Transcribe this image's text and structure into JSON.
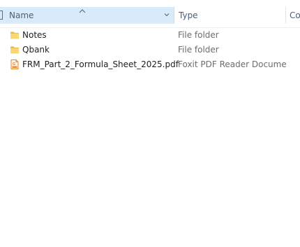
{
  "columns": {
    "name": "Name",
    "type": "Type",
    "date_partial": "Co"
  },
  "files": [
    {
      "name": "Notes",
      "type": "File folder",
      "icon": "folder-icon"
    },
    {
      "name": "Qbank",
      "type": "File folder",
      "icon": "folder-icon"
    },
    {
      "name": "FRM_Part_2_Formula_Sheet_2025.pdf",
      "type": "Foxit PDF Reader Docume...",
      "icon": "foxit-pdf-icon"
    }
  ],
  "colors": {
    "header_selected_bg": "#d9ebf9",
    "header_text": "#4c607a",
    "folder_yellow": "#f8d775",
    "pdf_orange": "#e8892b"
  }
}
